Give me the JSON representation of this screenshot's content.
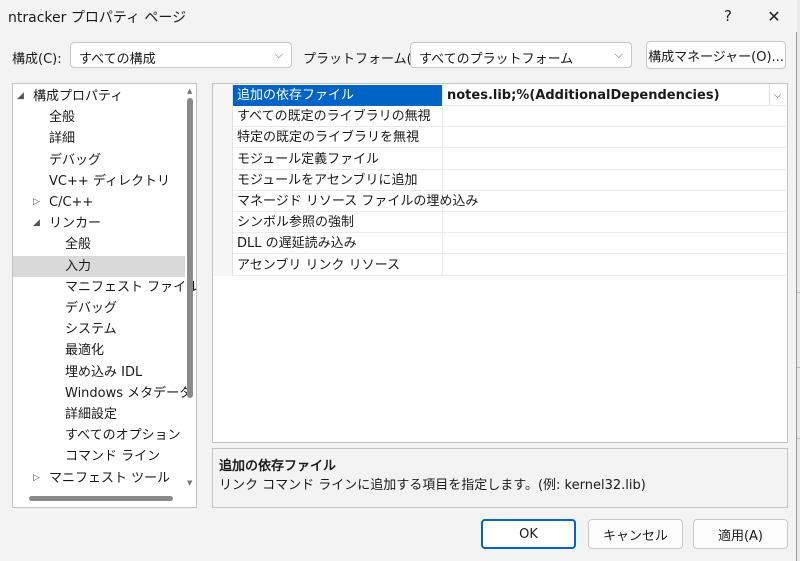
{
  "window": {
    "title": "ntracker プロパティ ページ",
    "help": "?",
    "close": "✕"
  },
  "toolbar": {
    "config_label": "構成(C):",
    "config_value": "すべての構成",
    "platform_label": "プラットフォーム(P):",
    "platform_value": "すべてのプラットフォーム",
    "manager_button": "構成マネージャー(O)..."
  },
  "tree": {
    "items": [
      {
        "label": "構成プロパティ",
        "expander": "◢"
      },
      {
        "label": "全般"
      },
      {
        "label": "詳細"
      },
      {
        "label": "デバッグ"
      },
      {
        "label": "VC++ ディレクトリ"
      },
      {
        "label": "C/C++",
        "expander": "▷"
      },
      {
        "label": "リンカー",
        "expander": "◢"
      },
      {
        "label": "全般"
      },
      {
        "label": "入力"
      },
      {
        "label": "マニフェスト ファイル"
      },
      {
        "label": "デバッグ"
      },
      {
        "label": "システム"
      },
      {
        "label": "最適化"
      },
      {
        "label": "埋め込み IDL"
      },
      {
        "label": "Windows メタデータ"
      },
      {
        "label": "詳細設定"
      },
      {
        "label": "すべてのオプション"
      },
      {
        "label": "コマンド ライン"
      },
      {
        "label": "マニフェスト ツール",
        "expander": "▷"
      }
    ],
    "selected": "入力"
  },
  "grid": {
    "rows": [
      {
        "name": "追加の依存ファイル",
        "value": "notes.lib;%(AdditionalDependencies)"
      },
      {
        "name": "すべての既定のライブラリの無視",
        "value": ""
      },
      {
        "name": "特定の既定のライブラリを無視",
        "value": ""
      },
      {
        "name": "モジュール定義ファイル",
        "value": ""
      },
      {
        "name": "モジュールをアセンブリに追加",
        "value": ""
      },
      {
        "name": "マネージド リソース ファイルの埋め込み",
        "value": ""
      },
      {
        "name": "シンボル参照の強制",
        "value": ""
      },
      {
        "name": "DLL の遅延読み込み",
        "value": ""
      },
      {
        "name": "アセンブリ リンク リソース",
        "value": ""
      }
    ]
  },
  "description": {
    "title": "追加の依存ファイル",
    "text": "リンク コマンド ラインに追加する項目を指定します。(例: kernel32.lib)"
  },
  "buttons": {
    "ok": "OK",
    "cancel": "キャンセル",
    "apply": "適用(A)"
  },
  "colors": {
    "accent": "#0063c6",
    "selection": "#d9d9d9"
  }
}
